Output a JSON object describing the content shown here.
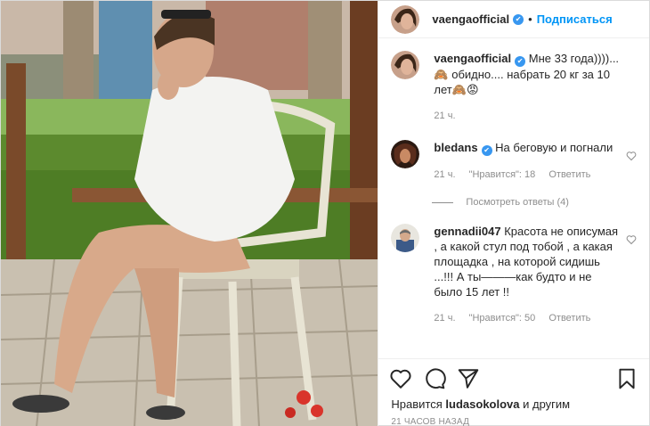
{
  "post": {
    "author": "vaengaofficial",
    "follow_label": "Подписаться",
    "dot": "•"
  },
  "caption": {
    "user": "vaengaofficial",
    "text": "Мне 33 года))))...🙈 обидно.... набрать 20 кг за 10 лет🙈😡",
    "time": "21 ч."
  },
  "comments": [
    {
      "user": "bledans",
      "verified": true,
      "text": "На беговую и погнали",
      "time": "21 ч.",
      "likes": "\"Нравится\": 18",
      "reply": "Ответить"
    },
    {
      "user": "gennadii047",
      "verified": false,
      "text": "Красота не описумая , а какой стул под тобой , а какая площадка , на которой сидишь ...!!! А ты———как будто и не было 15 лет !!",
      "time": "21 ч.",
      "likes": "\"Нравится\": 50",
      "reply": "Ответить"
    }
  ],
  "view_replies": "Посмотреть ответы (4)",
  "likes_line": {
    "prefix": "Нравится",
    "user": "ludasokolova",
    "suffix": "и другим"
  },
  "time_ago": "21 часов назад",
  "icons": {
    "like": "heart-icon",
    "comment": "comment-icon",
    "share": "paper-plane-icon",
    "save": "bookmark-icon",
    "verified": "verified-badge-icon"
  },
  "colors": {
    "link": "#0095f6",
    "verified": "#3897f0",
    "muted": "#8e8e8e"
  }
}
